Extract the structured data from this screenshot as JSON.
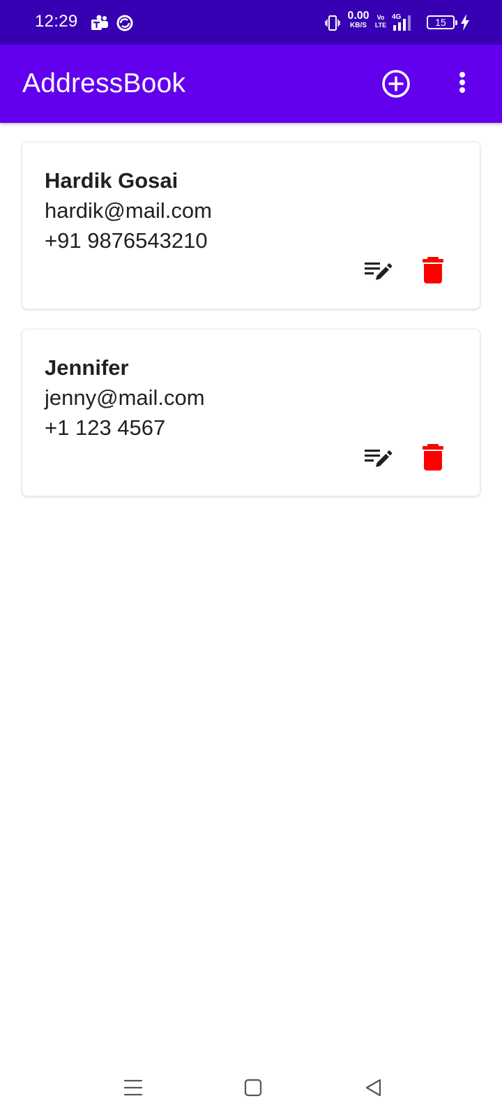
{
  "status_bar": {
    "time": "12:29",
    "net_speed_value": "0.00",
    "net_speed_unit": "KB/S",
    "volte_top": "Vo",
    "volte_bottom": "LTE",
    "network": "4G",
    "battery_level": "15",
    "icons": [
      "teams-icon",
      "sync-icon",
      "vibrate-icon",
      "signal-icon",
      "battery-icon",
      "charging-icon"
    ]
  },
  "app_bar": {
    "title": "AddressBook",
    "actions": [
      "add-circle-icon",
      "more-vert-icon"
    ]
  },
  "contacts": [
    {
      "name": "Hardik Gosai",
      "email": "hardik@mail.com",
      "phone": "+91 9876543210"
    },
    {
      "name": "Jennifer",
      "email": "jenny@mail.com",
      "phone": "+1 123 4567"
    }
  ],
  "colors": {
    "status_bar": "#3700b3",
    "app_bar": "#6200ee",
    "delete_icon": "#ff0000",
    "edit_icon": "#212121",
    "text": "#212121"
  },
  "nav_bar": {
    "buttons": [
      "menu-icon",
      "home-icon",
      "back-icon"
    ]
  }
}
